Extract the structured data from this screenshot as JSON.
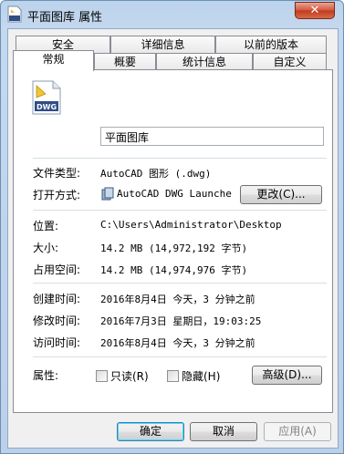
{
  "window": {
    "title": "平面图库 属性",
    "close_label": "✕"
  },
  "tabs_back": [
    "安全",
    "详细信息",
    "以前的版本"
  ],
  "tabs_front": [
    "常规",
    "概要",
    "统计信息",
    "自定义"
  ],
  "file_icon_text": "DWG",
  "general": {
    "file_name": "平面图库",
    "file_type_label": "文件类型:",
    "file_type_value": "AutoCAD 图形 (.dwg)",
    "opens_with_label": "打开方式:",
    "opens_with_value": "AutoCAD DWG Launche",
    "change_button": "更改(C)...",
    "location_label": "位置:",
    "location_value": "C:\\Users\\Administrator\\Desktop",
    "size_label": "大小:",
    "size_value": "14.2 MB (14,972,192 字节)",
    "size_on_disk_label": "占用空间:",
    "size_on_disk_value": "14.2 MB (14,974,976 字节)",
    "created_label": "创建时间:",
    "created_value": "2016年8月4日 今天，3 分钟之前",
    "modified_label": "修改时间:",
    "modified_value": "2016年7月3日 星期日，19:03:25",
    "accessed_label": "访问时间:",
    "accessed_value": "2016年8月4日 今天，3 分钟之前",
    "attributes_label": "属性:",
    "readonly_label": "只读(R)",
    "hidden_label": "隐藏(H)",
    "advanced_button": "高级(D)..."
  },
  "footer": {
    "ok": "确定",
    "cancel": "取消",
    "apply": "应用(A)"
  }
}
